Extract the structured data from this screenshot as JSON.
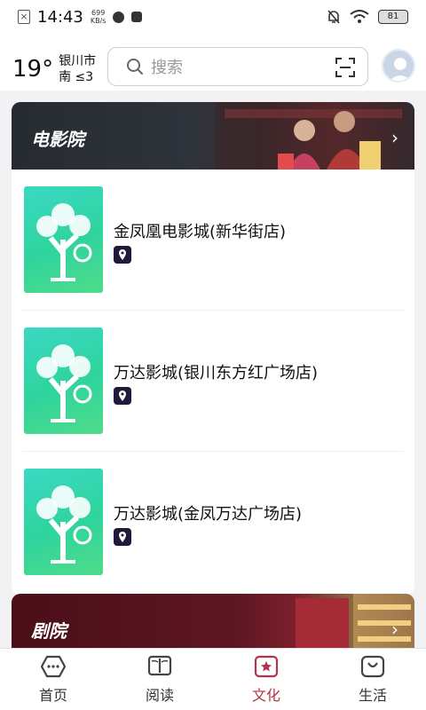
{
  "status_bar": {
    "time": "14:43",
    "net_speed_value": "699",
    "net_speed_unit": "KB/s",
    "battery": "81"
  },
  "header": {
    "temperature": "19°",
    "city": "银川市",
    "wind": "南 ≤3",
    "search_placeholder": "搜索"
  },
  "sections": [
    {
      "title": "电影院",
      "items": [
        {
          "name": "金凤凰电影城(新华街店)"
        },
        {
          "name": "万达影城(银川东方红广场店)"
        },
        {
          "name": "万达影城(金凤万达广场店)"
        }
      ]
    },
    {
      "title": "剧院"
    }
  ],
  "bottom_nav": [
    {
      "label": "首页",
      "icon": "home-icon"
    },
    {
      "label": "阅读",
      "icon": "book-icon"
    },
    {
      "label": "文化",
      "icon": "star-icon",
      "active": true
    },
    {
      "label": "生活",
      "icon": "bag-icon"
    }
  ],
  "colors": {
    "accent": "#b8324a",
    "cinema_banner": "#2a2f36",
    "theater_banner": "#5a1420",
    "thumb_green": "#2fd49d"
  }
}
